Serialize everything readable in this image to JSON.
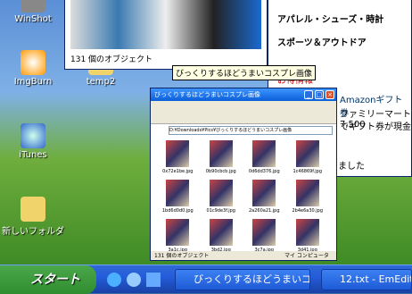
{
  "desktop_icons": [
    {
      "label": "WinShot",
      "icon": "winshot-icon"
    },
    {
      "label": "ImgBurn",
      "icon": "imgburn-icon"
    },
    {
      "label": "temp2",
      "icon": "folder-icon"
    },
    {
      "label": "iTunes",
      "icon": "itunes-icon"
    },
    {
      "label": "新しいフォルダ",
      "icon": "folder-icon"
    }
  ],
  "back_window": {
    "status": "131 個のオブジェクト"
  },
  "menu_panel": {
    "items": [
      "アパレル・シューズ・時計",
      "スポーツ＆アウトドア"
    ],
    "heading": "お得情報",
    "ad1": "Amazonギフト券",
    "ad2": "ファミリーマート7,500",
    "ad3": "でギフト券が現金",
    "footer": "ました"
  },
  "tooltip": "びっくりするほどうまいコスプレ画像",
  "explorer": {
    "title": "びっくりするほどうまいコスプレ画像",
    "address": "D:¥Downloads¥Pics¥びっくりするほどうまいコスプレ画像",
    "status": "131 個のオブジェクト",
    "zone": "マイ コンピュータ",
    "files": [
      "0x72e1be.jpg",
      "0b90cbcb.jpg",
      "0d6dd376.jpg",
      "1c46869f.jpg",
      "1bd6d0d0.jpg",
      "01c9de3f.jpg",
      "2a260a21.jpg",
      "2b4e6a30.jpg",
      "3a1c.jpg",
      "3bd2.jpg",
      "3c7a.jpg",
      "3d41.jpg"
    ]
  },
  "taskbar": {
    "start": "スタート",
    "btn1": "びっくりするほどうまいコ...",
    "btn2": "12.txt - EmEdit"
  }
}
